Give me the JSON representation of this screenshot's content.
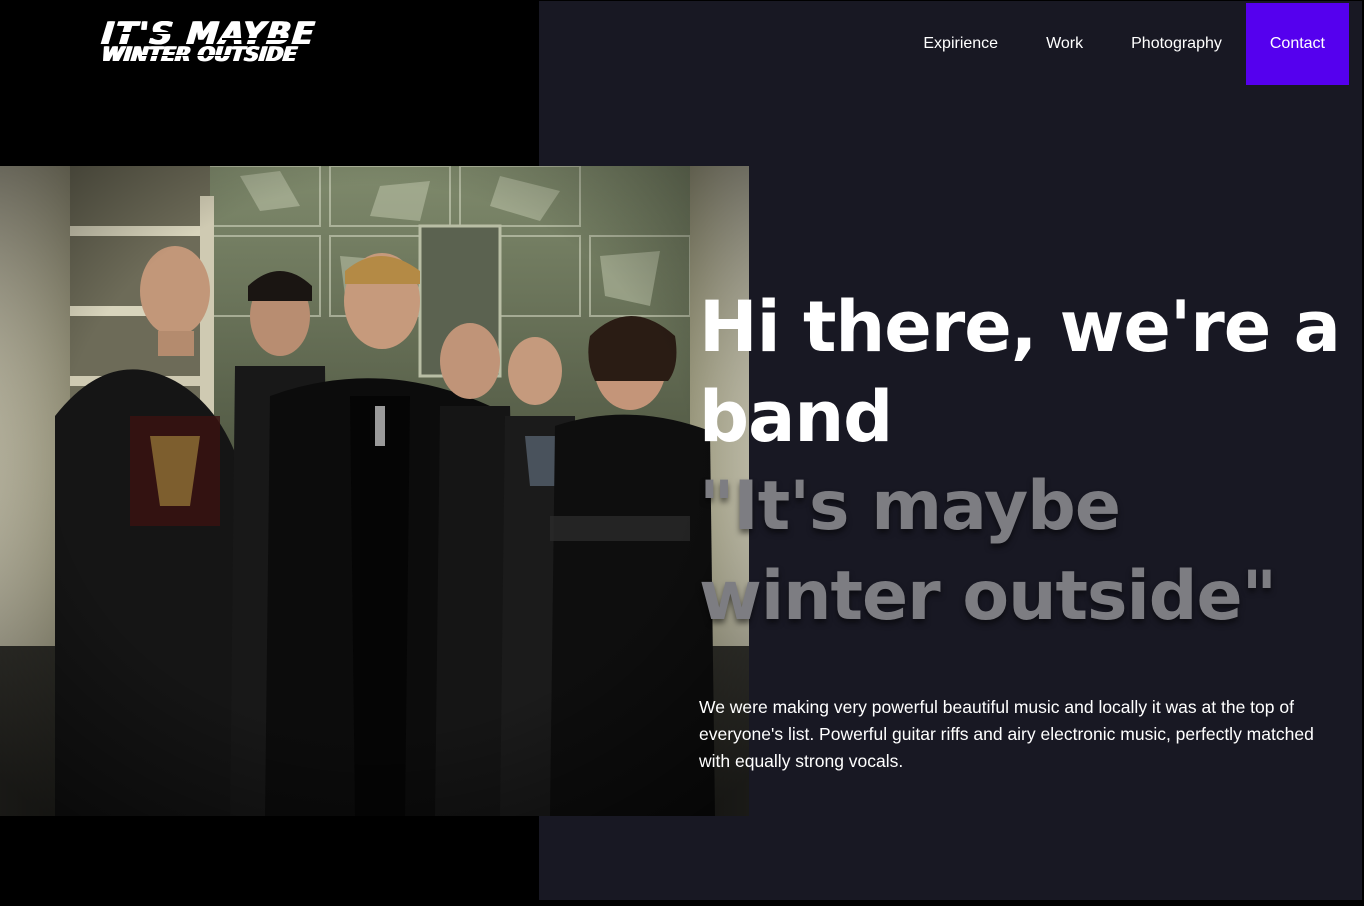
{
  "logo": {
    "line1": "IT'S MAYBE",
    "line2": "WINTER OUTSIDE"
  },
  "nav": {
    "items": [
      {
        "label": "Expirience"
      },
      {
        "label": "Work"
      },
      {
        "label": "Photography"
      },
      {
        "label": "Contact",
        "active": true
      }
    ]
  },
  "hero": {
    "title": "Hi there, we're a band",
    "subtitle": "\"It's maybe winter outside\"",
    "description": "We were making very powerful beautiful music and locally it was at the top of everyone's list. Powerful guitar riffs and airy electronic music, perfectly matched with equally strong vocals."
  },
  "colors": {
    "background": "#000000",
    "panel": "#181823",
    "accent": "#5500ee",
    "subtitle": "#7d7d82"
  }
}
